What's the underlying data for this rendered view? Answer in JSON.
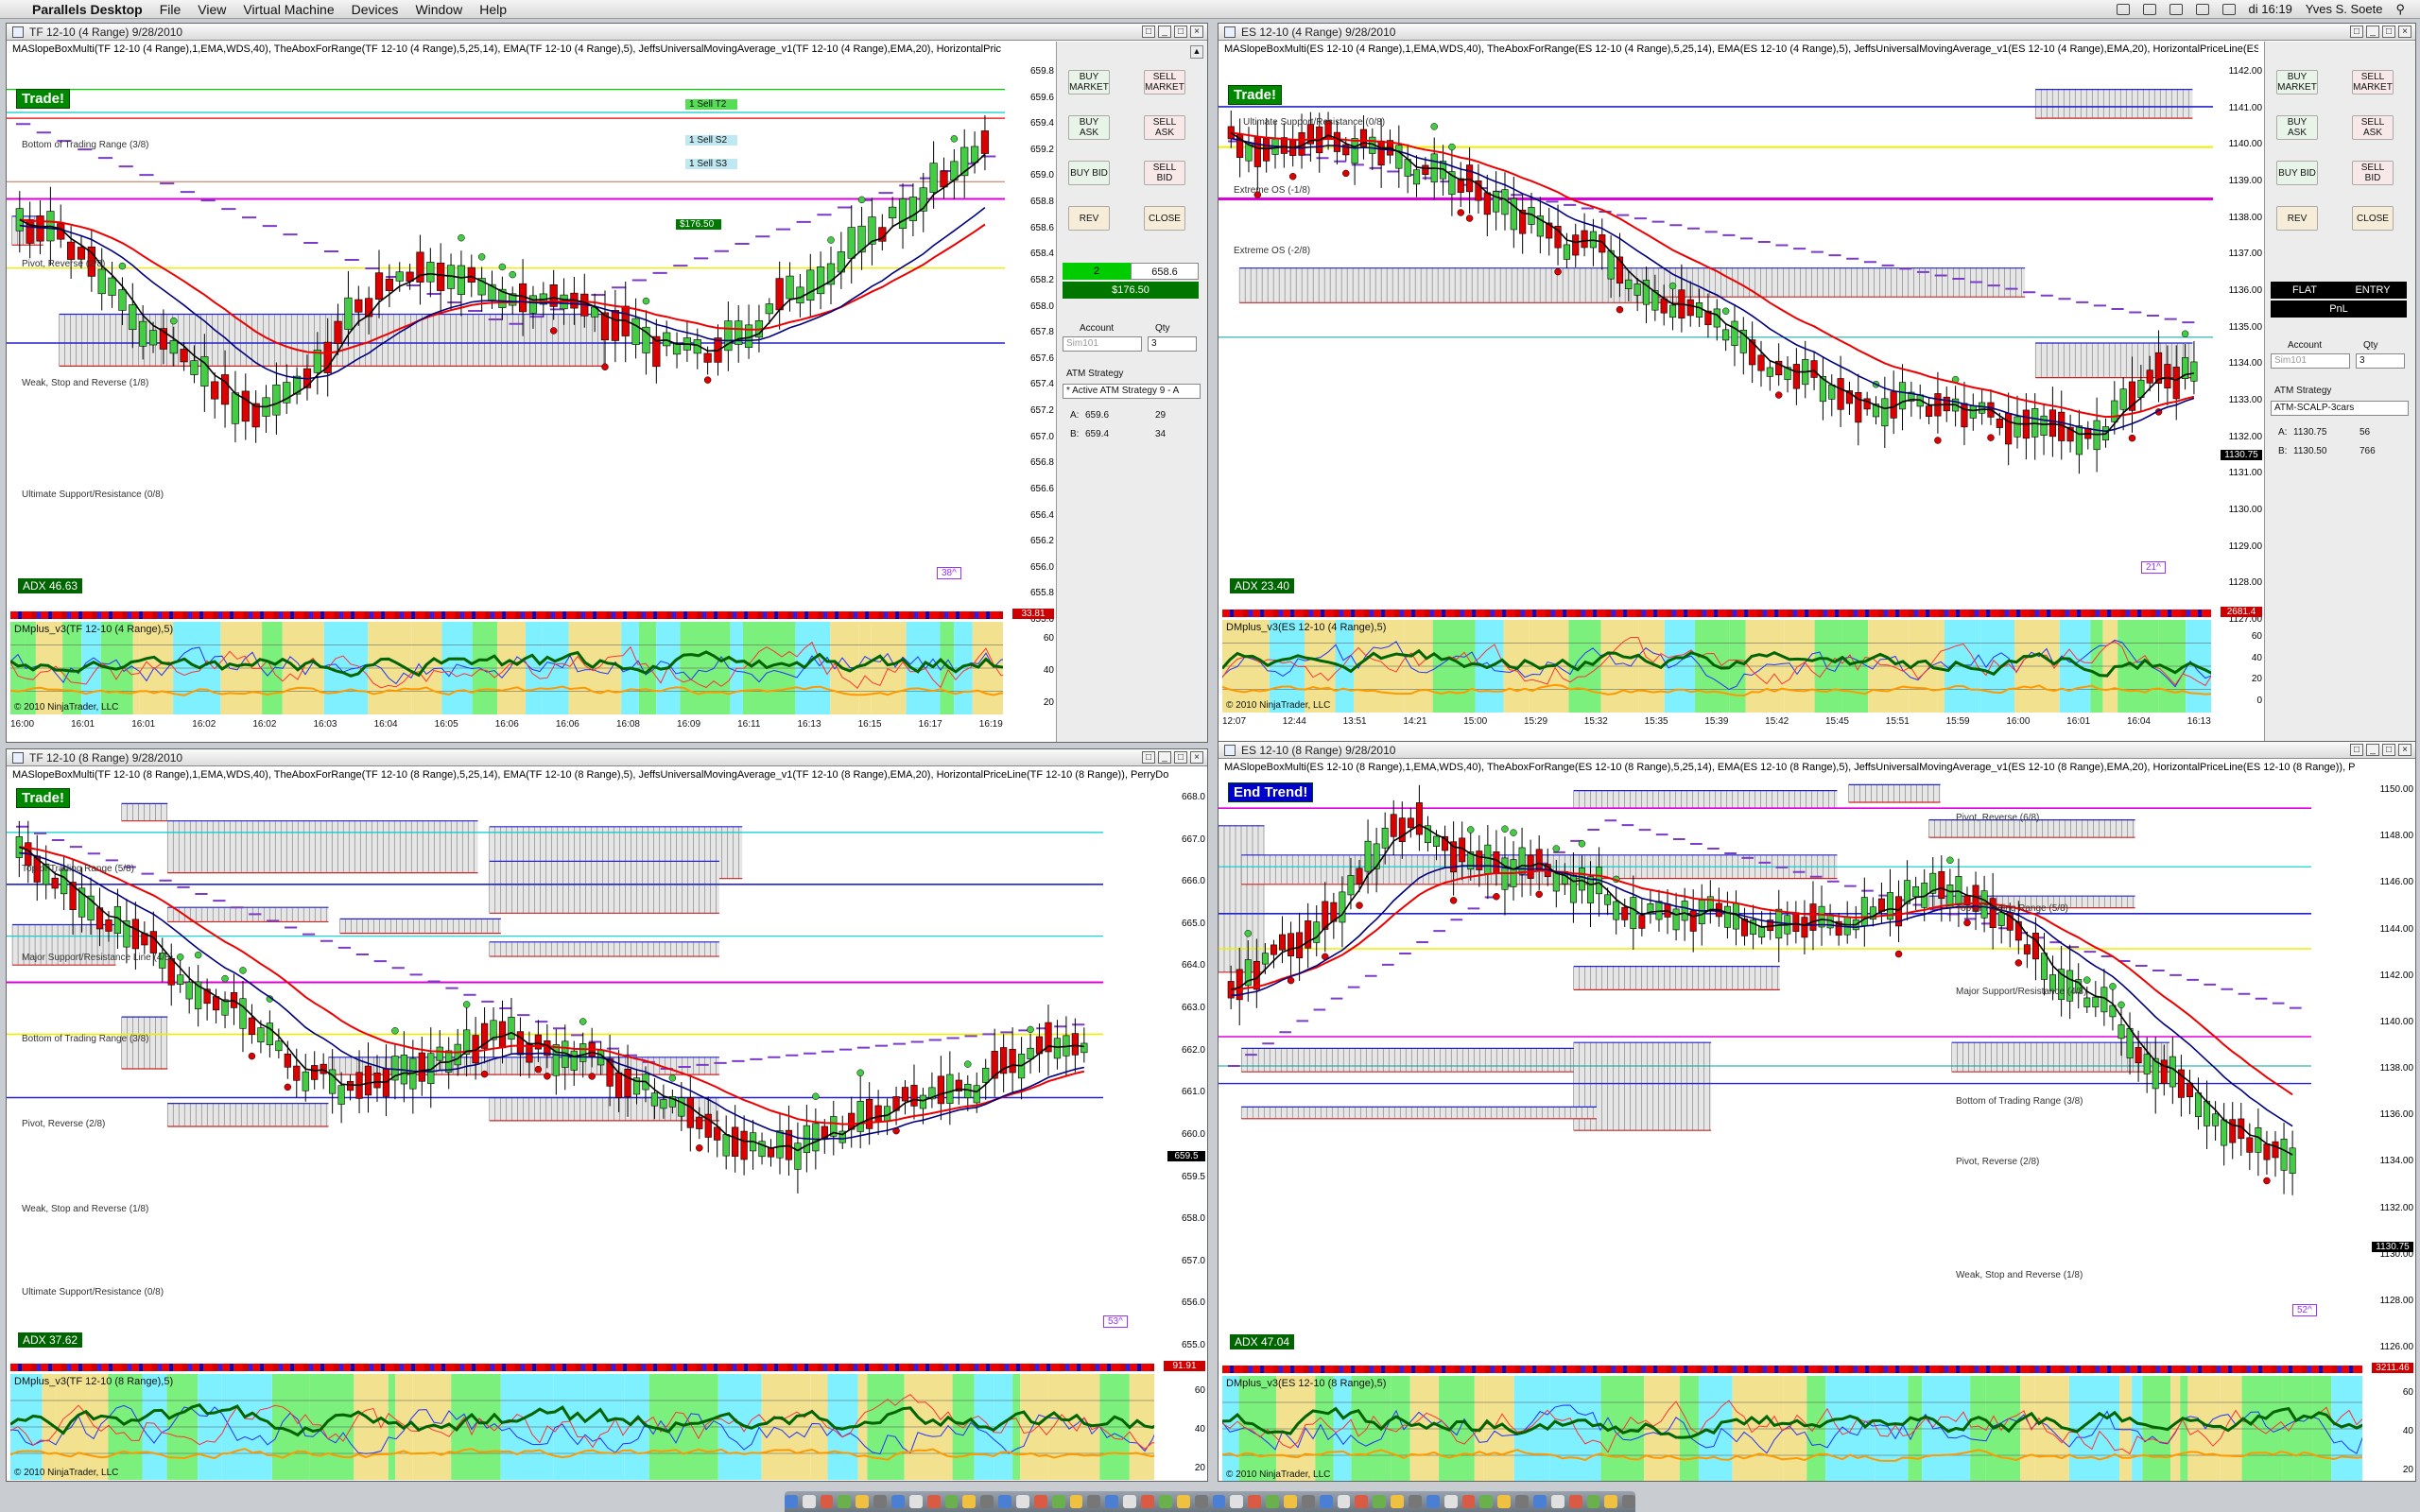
{
  "menubar": {
    "app": "Parallels Desktop",
    "items": [
      "File",
      "View",
      "Virtual Machine",
      "Devices",
      "Window",
      "Help"
    ],
    "clock": "di 16:19",
    "user": "Yves S. Soete"
  },
  "windows": {
    "tl": {
      "title": "TF 12-10 (4 Range)  9/28/2010",
      "indicators": "MASlopeBoxMulti(TF 12-10 (4 Range),1,EMA,WDS,40), TheAboxForRange(TF 12-10 (4 Range),5,25,14), EMA(TF 12-10 (4 Range),5), JeffsUniversalMovingAverage_v1(TF 12-10 (4 Range),EMA,20), HorizontalPric",
      "signal": "Trade!",
      "adx": "ADX 46.63",
      "yticks": [
        "659.8",
        "659.6",
        "659.4",
        "659.2",
        "659.0",
        "658.8",
        "658.6",
        "658.4",
        "658.2",
        "658.0",
        "657.8",
        "657.6",
        "657.4",
        "657.2",
        "657.0",
        "656.8",
        "656.6",
        "656.4",
        "656.2",
        "656.0",
        "655.8",
        "655.6"
      ],
      "levels": [
        {
          "text": "Bottom of Trading Range (3/8)"
        },
        {
          "text": "Pivot, Reverse (2/8)"
        },
        {
          "text": "Weak, Stop and Reverse (1/8)"
        },
        {
          "text": "Ultimate Support/Resistance (0/8)"
        }
      ],
      "orders": [
        "1  Sell T2",
        "1  Sell S2",
        "1  Sell S3",
        "$176.50"
      ],
      "order_prices": [
        "659.6",
        "659.5",
        "659.3",
        "659.1",
        "658.6"
      ],
      "box_label": "38^",
      "osc_label": "DMplus_v3(TF 12-10 (4 Range),5)",
      "osc_ticks": [
        "60",
        "40",
        "20"
      ],
      "redline_value": "33.81",
      "copyright": "© 2010 NinjaTrader, LLC",
      "xticks": [
        "16:00",
        "16:01",
        "16:01",
        "16:02",
        "16:02",
        "16:03",
        "16:04",
        "16:05",
        "16:06",
        "16:06",
        "16:08",
        "16:09",
        "16:11",
        "16:13",
        "16:15",
        "16:17",
        "16:19"
      ]
    },
    "tr": {
      "title": "ES 12-10 (4 Range)  9/28/2010",
      "indicators": "MASlopeBoxMulti(ES 12-10 (4 Range),1,EMA,WDS,40), TheAboxForRange(ES 12-10 (4 Range),5,25,14), EMA(ES 12-10 (4 Range),5), JeffsUniversalMovingAverage_v1(ES 12-10 (4 Range),EMA,20), HorizontalPriceLine(ES 12-10 (4 Range",
      "signal": "Trade!",
      "adx": "ADX 23.40",
      "yticks": [
        "1142.00",
        "1141.00",
        "1140.00",
        "1139.00",
        "1138.00",
        "1137.00",
        "1136.00",
        "1135.00",
        "1134.00",
        "1133.00",
        "1132.00",
        "1131.00",
        "1130.00",
        "1129.00",
        "1128.00",
        "1127.00"
      ],
      "levels": [
        {
          "text": "Ultimate Support/Resistance (0/8)"
        },
        {
          "text": "Extreme OS (-1/8)"
        },
        {
          "text": "Extreme OS (-2/8)"
        }
      ],
      "box_label": "21^",
      "price_box": "1130.75",
      "osc_label": "DMplus_v3(ES 12-10 (4 Range),5)",
      "osc_ticks": [
        "60",
        "40",
        "20",
        "0"
      ],
      "redline_value": "2681.4",
      "copyright": "© 2010 NinjaTrader, LLC",
      "xticks": [
        "12:07",
        "12:44",
        "13:51",
        "14:21",
        "15:00",
        "15:29",
        "15:32",
        "15:35",
        "15:39",
        "15:42",
        "15:45",
        "15:51",
        "15:59",
        "16:00",
        "16:01",
        "16:04",
        "16:13"
      ]
    },
    "bl": {
      "title": "TF 12-10 (8 Range)  9/28/2010",
      "indicators": "MASlopeBoxMulti(TF 12-10 (8 Range),1,EMA,WDS,40), TheAboxForRange(TF 12-10 (8 Range),5,25,14), EMA(TF 12-10 (8 Range),5), JeffsUniversalMovingAverage_v1(TF 12-10 (8 Range),EMA,20), HorizontalPriceLine(TF 12-10 (8 Range)), PerryDo",
      "signal": "Trade!",
      "adx": "ADX 37.62",
      "yticks": [
        "668.0",
        "667.0",
        "666.0",
        "665.0",
        "664.0",
        "663.0",
        "662.0",
        "661.0",
        "660.0",
        "659.5",
        "658.0",
        "657.0",
        "656.0",
        "655.0"
      ],
      "levels": [
        {
          "text": "Top of Trading Range (5/8)"
        },
        {
          "text": "Major Support/Resistance Line (4/8)"
        },
        {
          "text": "Bottom of Trading Range (3/8)"
        },
        {
          "text": "Pivot, Reverse (2/8)"
        },
        {
          "text": "Weak, Stop and Reverse (1/8)"
        },
        {
          "text": "Ultimate Support/Resistance (0/8)"
        }
      ],
      "box_label": "53^",
      "price_box": "659.5",
      "osc_label": "DMplus_v3(TF 12-10 (8 Range),5)",
      "osc_ticks": [
        "60",
        "40",
        "20"
      ],
      "redline_value": "91.91",
      "copyright": "© 2010 NinjaTrader, LLC"
    },
    "br": {
      "title": "ES 12-10 (8 Range)  9/28/2010",
      "indicators": "MASlopeBoxMulti(ES 12-10 (8 Range),1,EMA,WDS,40), TheAboxForRange(ES 12-10 (8 Range),5,25,14), EMA(ES 12-10 (8 Range),5), JeffsUniversalMovingAverage_v1(ES 12-10 (8 Range),EMA,20), HorizontalPriceLine(ES 12-10 (8 Range)), P",
      "signal": "End Trend!",
      "adx": "ADX 47.04",
      "yticks": [
        "1150.00",
        "1148.00",
        "1146.00",
        "1144.00",
        "1142.00",
        "1140.00",
        "1138.00",
        "1136.00",
        "1134.00",
        "1132.00",
        "1130.00",
        "1128.00",
        "1126.00"
      ],
      "levels": [
        {
          "text": "Pivot, Reverse (6/8)"
        },
        {
          "text": "Top of Trading Range (5/8)"
        },
        {
          "text": "Major Support/Resistance (4/8)"
        },
        {
          "text": "Bottom of Trading Range (3/8)"
        },
        {
          "text": "Pivot, Reverse (2/8)"
        },
        {
          "text": "Weak, Stop and Reverse (1/8)"
        }
      ],
      "box_label": "52^",
      "price_box": "1130.75",
      "osc_label": "DMplus_v3(ES 12-10 (8 Range),5)",
      "osc_ticks": [
        "60",
        "40",
        "20"
      ],
      "redline_value": "3211.46",
      "copyright": "© 2010 NinjaTrader, LLC"
    }
  },
  "panel_left": {
    "buy_market": "BUY MARKET",
    "sell_market": "SELL MARKET",
    "buy_ask": "BUY ASK",
    "sell_ask": "SELL ASK",
    "buy_bid": "BUY BID",
    "sell_bid": "SELL BID",
    "rev": "REV",
    "close": "CLOSE",
    "position_qty": "2",
    "position_price": "658.6",
    "pnl": "$176.50",
    "account_label": "Account",
    "account": "Sim101",
    "qty_label": "Qty",
    "qty": "3",
    "atm_label": "ATM Strategy",
    "atm": "* Active ATM Strategy 9 - A",
    "ask_label": "A:",
    "ask": "659.6",
    "ask_size": "29",
    "bid_label": "B:",
    "bid": "659.4",
    "bid_size": "34"
  },
  "panel_right": {
    "buy_market": "BUY MARKET",
    "sell_market": "SELL MARKET",
    "buy_ask": "BUY ASK",
    "sell_ask": "SELL ASK",
    "buy_bid": "BUY BID",
    "sell_bid": "SELL BID",
    "rev": "REV",
    "close": "CLOSE",
    "flat": "FLAT",
    "entry": "ENTRY",
    "pnl": "PnL",
    "account_label": "Account",
    "account": "Sim101",
    "qty_label": "Qty",
    "qty": "3",
    "atm_label": "ATM Strategy",
    "atm": "ATM-SCALP-3cars",
    "ask_label": "A:",
    "ask": "1130.75",
    "ask_size": "56",
    "bid_label": "B:",
    "bid": "1130.50",
    "bid_size": "766"
  },
  "colors": {
    "bull": "#44cc44",
    "bear": "#dd0000",
    "ema_fast": "#000000",
    "ema_slow": "#ee0000",
    "jma": "#000080",
    "magenta": "#dd00dd",
    "cyan": "#00cccc",
    "yellow_bg": "#f2e28f",
    "green_bg": "#7cf07c",
    "cyan_bg": "#7ff0ff"
  }
}
